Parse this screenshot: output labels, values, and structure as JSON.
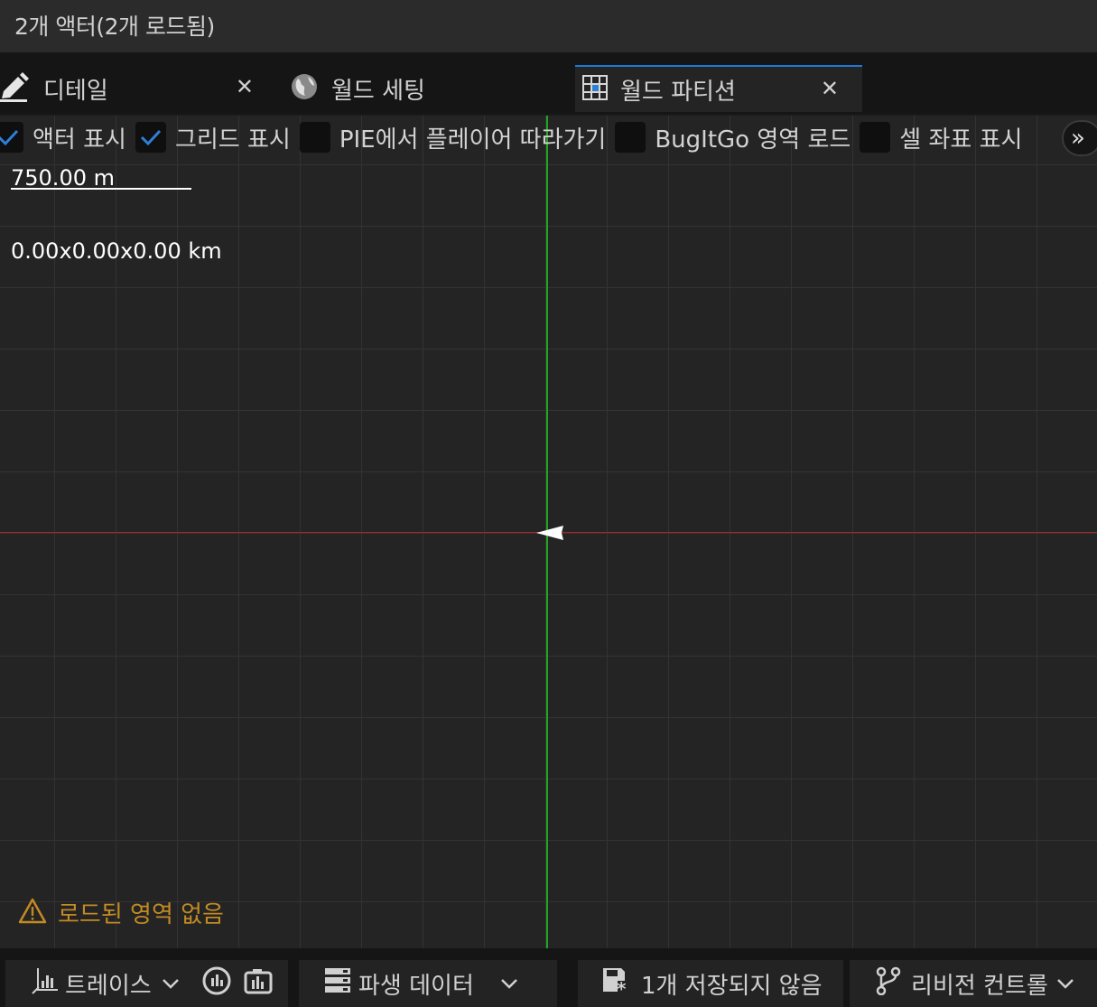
{
  "header": {
    "title": "2개 액터(2개 로드됨)"
  },
  "tabs": [
    {
      "label": "디테일",
      "icon": "pencil-icon"
    },
    {
      "label": "월드 세팅",
      "icon": "globe-icon"
    },
    {
      "label": "월드 파티션",
      "icon": "grid-icon"
    }
  ],
  "close_glyph": "✕",
  "toolbar": {
    "options": [
      {
        "label": "액터 표시",
        "checked": true
      },
      {
        "label": "그리드 표시",
        "checked": true
      },
      {
        "label": "PIE에서 플레이어 따라가기",
        "checked": false
      },
      {
        "label": "BugItGo 영역 로드",
        "checked": false
      },
      {
        "label": "셀 좌표 표시",
        "checked": false
      }
    ],
    "overflow_glyph": "»"
  },
  "viewport": {
    "scale_label": "750.00 m",
    "bounds_label": "0.00x0.00x0.00 km",
    "warning": "로드된 영역 없음"
  },
  "statusbar": {
    "trace": "트레이스",
    "derived_data": "파생 데이터",
    "unsaved": "1개 저장되지 않음",
    "revision_control": "리비전 컨트롤"
  },
  "colors": {
    "accent": "#1e78d4",
    "checkmark": "#2f7fd8",
    "axis_x": "#b02424",
    "axis_y": "#1fa81f",
    "warning": "#c28a23"
  }
}
